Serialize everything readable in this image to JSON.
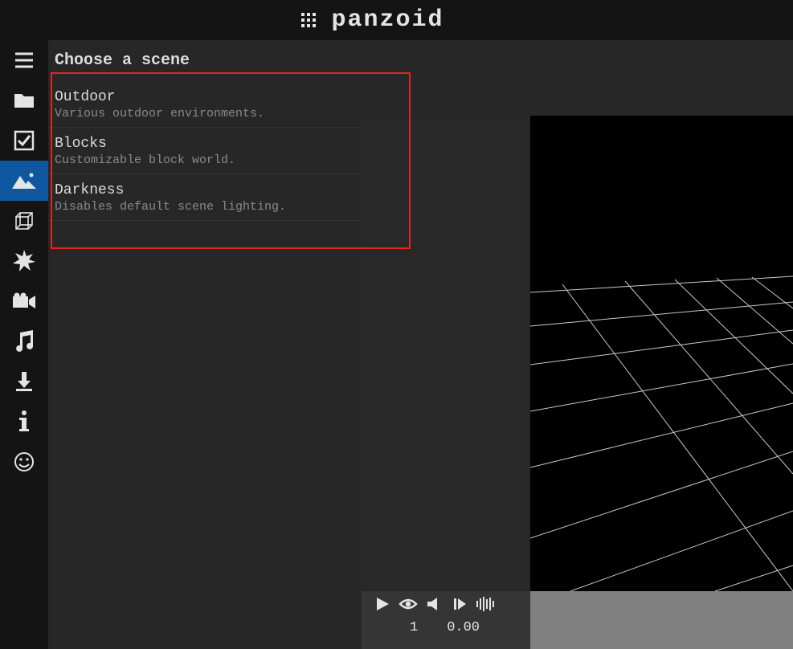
{
  "header": {
    "logo_text": "panzoid"
  },
  "panel": {
    "title": "Choose a scene",
    "scenes": [
      {
        "title": "Outdoor",
        "desc": "Various outdoor environments."
      },
      {
        "title": "Blocks",
        "desc": "Customizable block world."
      },
      {
        "title": "Darkness",
        "desc": "Disables default scene lighting."
      }
    ]
  },
  "toolbar": {
    "items": [
      "menu",
      "folder",
      "checkbox",
      "scene",
      "cube",
      "sparkle",
      "camera",
      "music",
      "download",
      "info",
      "smiley"
    ],
    "active_index": 3
  },
  "player": {
    "frame": "1",
    "time": "0.00"
  }
}
